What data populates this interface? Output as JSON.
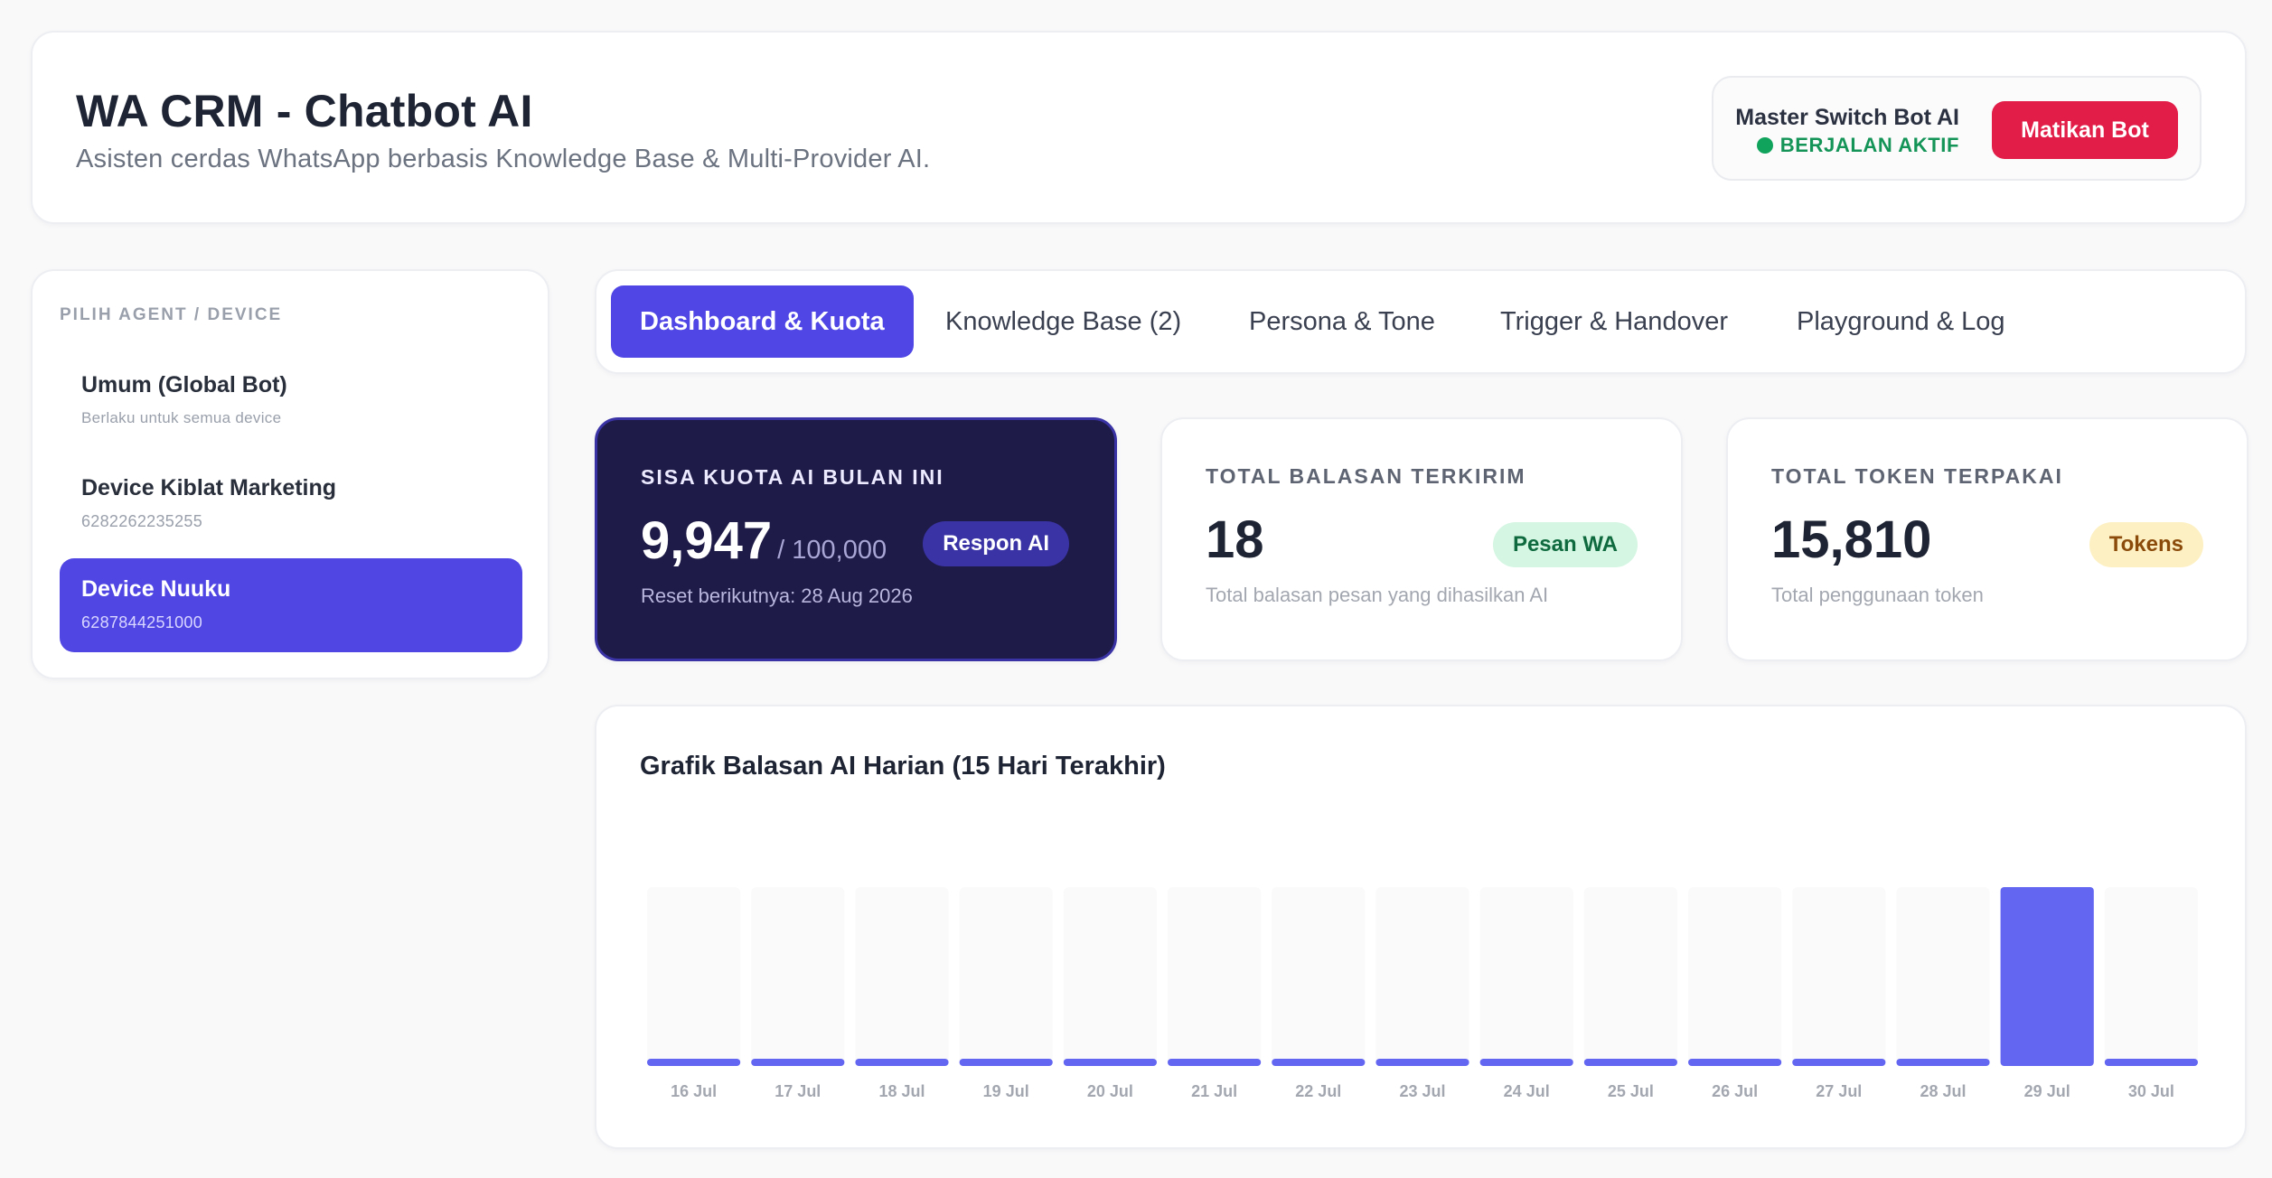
{
  "header": {
    "title": "WA CRM - Chatbot AI",
    "subtitle": "Asisten cerdas WhatsApp berbasis Knowledge Base & Multi-Provider AI.",
    "switch_label": "Master Switch Bot AI",
    "switch_status": "BERJALAN AKTIF",
    "stop_button": "Matikan Bot"
  },
  "sidebar": {
    "title": "PILIH AGENT / DEVICE",
    "items": [
      {
        "name": "Umum (Global Bot)",
        "sub": "Berlaku untuk semua device",
        "active": false
      },
      {
        "name": "Device Kiblat Marketing",
        "sub": "6282262235255",
        "active": false
      },
      {
        "name": "Device Nuuku",
        "sub": "6287844251000",
        "active": true
      }
    ]
  },
  "tabs": [
    {
      "label": "Dashboard & Kuota",
      "active": true
    },
    {
      "label": "Knowledge Base (2)",
      "active": false
    },
    {
      "label": "Persona & Tone",
      "active": false
    },
    {
      "label": "Trigger & Handover",
      "active": false
    },
    {
      "label": "Playground & Log",
      "active": false
    }
  ],
  "stats": {
    "quota": {
      "label": "SISA KUOTA AI BULAN INI",
      "value": "9,947",
      "suffix": "/ 100,000",
      "badge": "Respon AI",
      "note": "Reset berikutnya: 28 Aug 2026"
    },
    "replies": {
      "label": "TOTAL BALASAN TERKIRIM",
      "value": "18",
      "badge": "Pesan WA",
      "note": "Total balasan pesan yang dihasilkan AI"
    },
    "tokens": {
      "label": "TOTAL TOKEN TERPAKAI",
      "value": "15,810",
      "badge": "Tokens",
      "note": "Total penggunaan token"
    }
  },
  "colors": {
    "accent": "#4f46e5",
    "bar": "#6366f1",
    "bar_track": "#fafafb",
    "danger": "#e11d48",
    "success": "#10a35c"
  },
  "chart_data": {
    "type": "bar",
    "title": "Grafik Balasan AI Harian (15 Hari Terakhir)",
    "categories": [
      "16 Jul",
      "17 Jul",
      "18 Jul",
      "19 Jul",
      "20 Jul",
      "21 Jul",
      "22 Jul",
      "23 Jul",
      "24 Jul",
      "25 Jul",
      "26 Jul",
      "27 Jul",
      "28 Jul",
      "29 Jul",
      "30 Jul"
    ],
    "values": [
      0,
      0,
      0,
      0,
      0,
      0,
      0,
      0,
      0,
      0,
      0,
      0,
      0,
      18,
      0
    ],
    "ylim": [
      0,
      18
    ],
    "grid": false,
    "legend": "none"
  }
}
